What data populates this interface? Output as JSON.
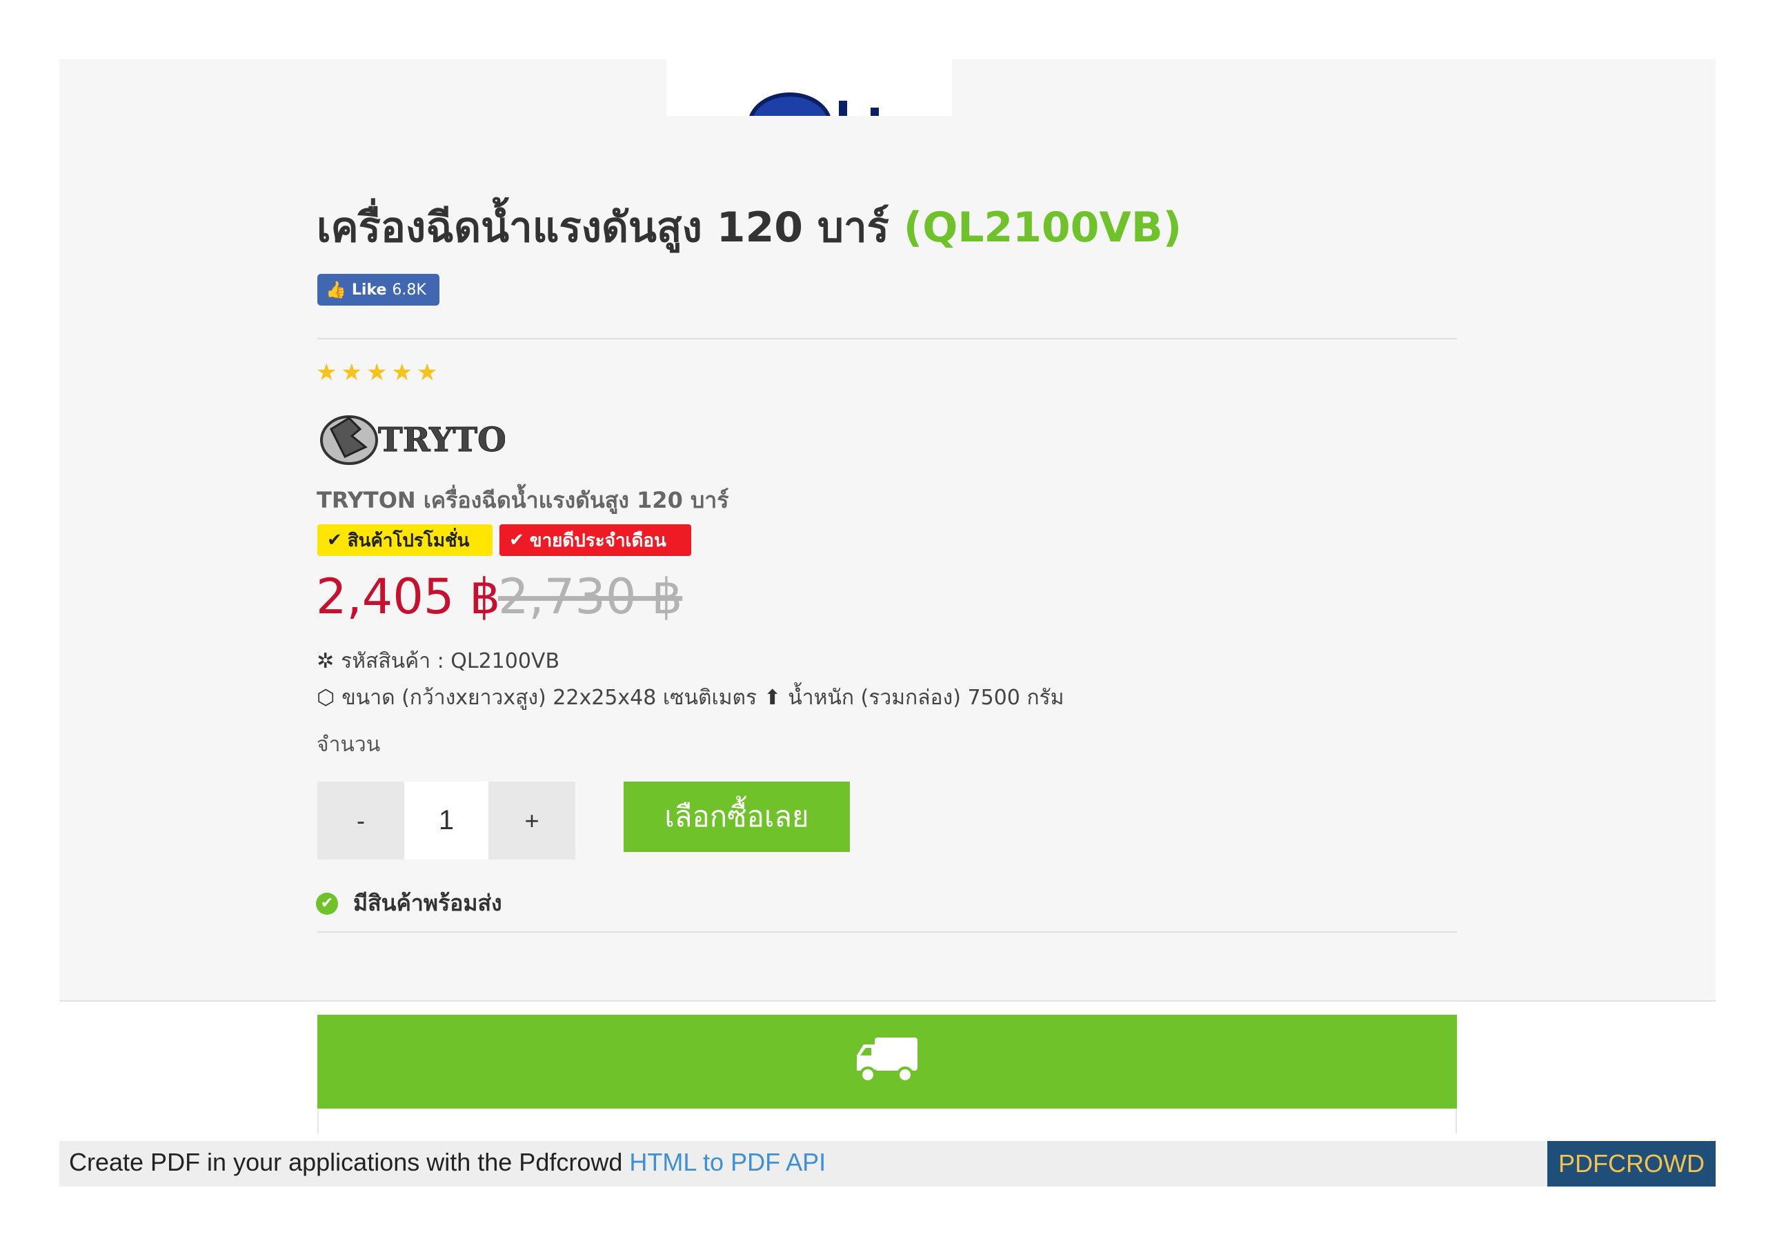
{
  "product": {
    "title": "เครื่องฉีดน้ำแรงดันสูง 120 บาร์",
    "code_badge": "(QL2100VB)",
    "brand_line": "TRYTON เครื่องฉีดน้ำแรงดันสูง 120 บาร์",
    "brand_logo_text": "TRYTON",
    "rating": 5,
    "price": "2,405 ฿",
    "old_price": "2,730 ฿",
    "sku_text": "รหัสสินค้า : QL2100VB",
    "size_text": "ขนาด (กว้างxยาวxสูง) 22x25x48 เซนติเมตร",
    "weight_text": "น้ำหนัก (รวมกล่อง) 7500 กรัม",
    "quantity_label": "จำนวน",
    "quantity": "1",
    "minus_label": "-",
    "plus_label": "+",
    "buy_label": "เลือกซื้อเลย",
    "stock_text": "มีสินค้าพร้อมส่ง"
  },
  "facebook": {
    "like_label": "Like",
    "like_count": "6.8K"
  },
  "badges": [
    {
      "label": "สินค้าโปรโมชั่น",
      "color": "#ffe600"
    },
    {
      "label": "ขายดีประจำเดือน",
      "color": "#ee1b24"
    }
  ],
  "colors": {
    "accent_green": "#6fc22a",
    "price_red": "#c8102e",
    "facebook_blue": "#4267b2"
  },
  "icons": {
    "star": "★",
    "check": "✔",
    "gear": "✲",
    "box": "⬡",
    "arrow_up": "⬆"
  },
  "footer": {
    "text": "Create PDF in your applications with the Pdfcrowd ",
    "link": "HTML to PDF API",
    "brand": "PDFCROWD"
  }
}
